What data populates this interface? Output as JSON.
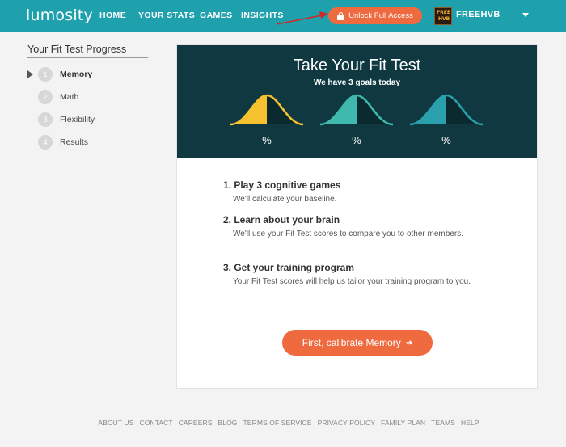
{
  "header": {
    "logo": "lumosity",
    "nav": [
      "HOME",
      "YOUR STATS",
      "GAMES",
      "INSIGHTS"
    ],
    "unlock_label": "Unlock Full Access",
    "avatar_text": [
      "FREE",
      "HVB"
    ],
    "username": "FREEHVB",
    "colors": {
      "bar": "#1fa0ad",
      "accent": "#ef6a3f"
    }
  },
  "sidebar": {
    "title": "Your Fit Test Progress",
    "steps": [
      {
        "num": "1",
        "label": "Memory",
        "active": true
      },
      {
        "num": "2",
        "label": "Math"
      },
      {
        "num": "3",
        "label": "Flexibility"
      },
      {
        "num": "4",
        "label": "Results"
      }
    ]
  },
  "hero": {
    "title": "Take Your Fit Test",
    "subtitle": "We have 3 goals today",
    "percent_labels": [
      "%",
      "%",
      "%"
    ],
    "colors": {
      "background": "#0f3840",
      "curve1": "#f5c12e",
      "curve2": "#3fb9ae",
      "curve3": "#2aa0ad"
    }
  },
  "goals": [
    {
      "title": "1. Play 3 cognitive games",
      "desc": "We'll calculate your baseline."
    },
    {
      "title": "2. Learn about your brain",
      "desc": "We'll use your Fit Test scores to compare you to other members."
    },
    {
      "title": "3. Get your training program",
      "desc": "Your Fit Test scores will help us tailor your training program to you."
    }
  ],
  "cta": {
    "label": "First, calibrate Memory",
    "arrow": "➜"
  },
  "footer": [
    "ABOUT US",
    "CONTACT",
    "CAREERS",
    "BLOG",
    "TERMS OF SERVICE",
    "PRIVACY POLICY",
    "FAMILY PLAN",
    "TEAMS",
    "HELP"
  ]
}
